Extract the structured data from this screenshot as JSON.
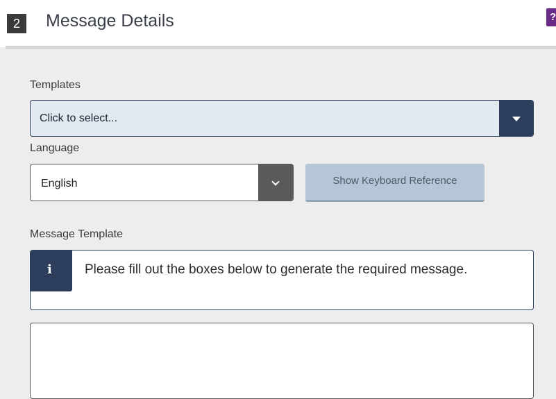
{
  "header": {
    "step_number": "2",
    "title": "Message Details",
    "help_label": "?"
  },
  "form": {
    "templates": {
      "label": "Templates",
      "value": "Click to select...",
      "icon": "caret-down-icon"
    },
    "language": {
      "label": "Language",
      "value": "English",
      "icon": "chevron-down-icon"
    },
    "keyboard_button": "Show Keyboard Reference",
    "message_template": {
      "label": "Message Template",
      "info_icon": "i",
      "info_text": "Please fill out the boxes below to generate the required message."
    },
    "message_body": {
      "value": ""
    }
  },
  "colors": {
    "navy": "#2c3e5c",
    "help_purple": "#6a2a87",
    "select_bg": "#e3e9f1",
    "button_bg": "#b5c7d7",
    "page_bg": "#ededed"
  }
}
